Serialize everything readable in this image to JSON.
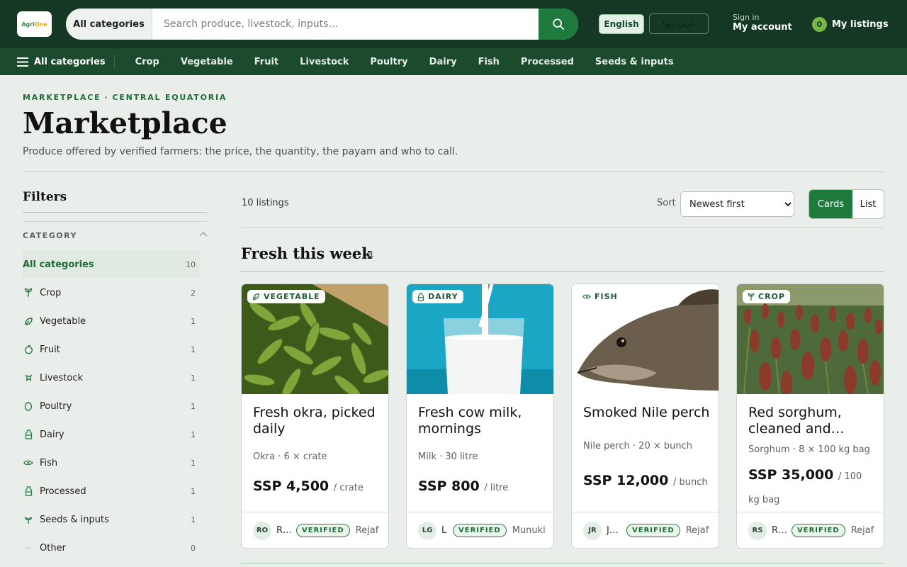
{
  "header": {
    "logo_text_a": "Agri",
    "logo_text_b": "One",
    "search_category": "All categories",
    "search_placeholder": "Search produce, livestock, inputs…",
    "lang_english": "English",
    "lang_arabic": "عربي جوبا",
    "sign_in": "Sign in",
    "my_account": "My account",
    "listings_count": "0",
    "my_listings": "My listings"
  },
  "nav": {
    "all_label": "All categories",
    "items": [
      "Crop",
      "Vegetable",
      "Fruit",
      "Livestock",
      "Poultry",
      "Dairy",
      "Fish",
      "Processed",
      "Seeds & inputs"
    ]
  },
  "page": {
    "crumb_a": "MARKETPLACE",
    "crumb_sep": "·",
    "crumb_b": "CENTRAL EQUATORIA",
    "title": "Marketplace",
    "description": "Produce offered by verified farmers: the price, the quantity, the payam and who to call."
  },
  "filters": {
    "heading": "Filters",
    "category_heading": "CATEGORY",
    "items": [
      {
        "label": "All categories",
        "count": "10",
        "icon": "all"
      },
      {
        "label": "Crop",
        "count": "2",
        "icon": "sprout-icon"
      },
      {
        "label": "Vegetable",
        "count": "1",
        "icon": "leaf-icon"
      },
      {
        "label": "Fruit",
        "count": "1",
        "icon": "apple-icon"
      },
      {
        "label": "Livestock",
        "count": "1",
        "icon": "cow-icon"
      },
      {
        "label": "Poultry",
        "count": "1",
        "icon": "egg-icon"
      },
      {
        "label": "Dairy",
        "count": "1",
        "icon": "bottle-icon"
      },
      {
        "label": "Fish",
        "count": "1",
        "icon": "fish-icon"
      },
      {
        "label": "Processed",
        "count": "1",
        "icon": "jar-icon"
      },
      {
        "label": "Seeds & inputs",
        "count": "1",
        "icon": "seedling-icon"
      },
      {
        "label": "Other",
        "count": "0",
        "icon": "dots-icon"
      }
    ]
  },
  "toolbar": {
    "count": "10 listings",
    "sort_label": "Sort",
    "sort_value": "Newest first",
    "view_cards": "Cards",
    "view_list": "List"
  },
  "section": {
    "title": "Fresh this week",
    "count": "4"
  },
  "cards": [
    {
      "tag": "VEGETABLE",
      "title": "Fresh okra, picked daily",
      "meta": "Okra · 6 × crate",
      "price": "SSP 4,500",
      "unit": "/ crate",
      "initials": "RO",
      "name": "R…",
      "verified": "VERIFIED",
      "location": "Rejaf"
    },
    {
      "tag": "DAIRY",
      "title": "Fresh cow milk, mornings",
      "meta": "Milk · 30 litre",
      "price": "SSP 800",
      "unit": "/ litre",
      "initials": "LG",
      "name": "L",
      "verified": "VERIFIED",
      "location": "Munuki"
    },
    {
      "tag": "FISH",
      "title": "Smoked Nile perch",
      "meta": "Nile perch · 20 × bunch",
      "price": "SSP 12,000",
      "unit": "/ bunch",
      "initials": "JR",
      "name": "J…",
      "verified": "VERIFIED",
      "location": "Rejaf"
    },
    {
      "tag": "CROP",
      "title": "Red sorghum, cleaned and…",
      "meta": "Sorghum · 8 × 100 kg bag",
      "price": "SSP 35,000",
      "unit": "/ 100 kg bag",
      "initials": "RS",
      "name": "R…",
      "verified": "VERIFIED",
      "location": "Rejaf"
    }
  ],
  "colors": {
    "brand_dark": "#153824",
    "accent": "#1f7a3e",
    "badge": "#7ab547"
  }
}
